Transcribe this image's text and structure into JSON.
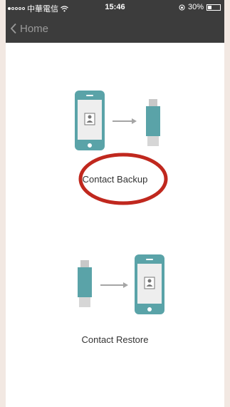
{
  "status_bar": {
    "carrier": "中華電信",
    "time": "15:46",
    "battery_percent": "30%",
    "battery_level": 0.3
  },
  "nav": {
    "back_label": "Home"
  },
  "actions": {
    "backup_label": "Contact Backup",
    "restore_label": "Contact Restore"
  },
  "colors": {
    "accent": "#5aa3a8",
    "nav_background": "#3c3c3c",
    "highlight": "#c0281e"
  }
}
